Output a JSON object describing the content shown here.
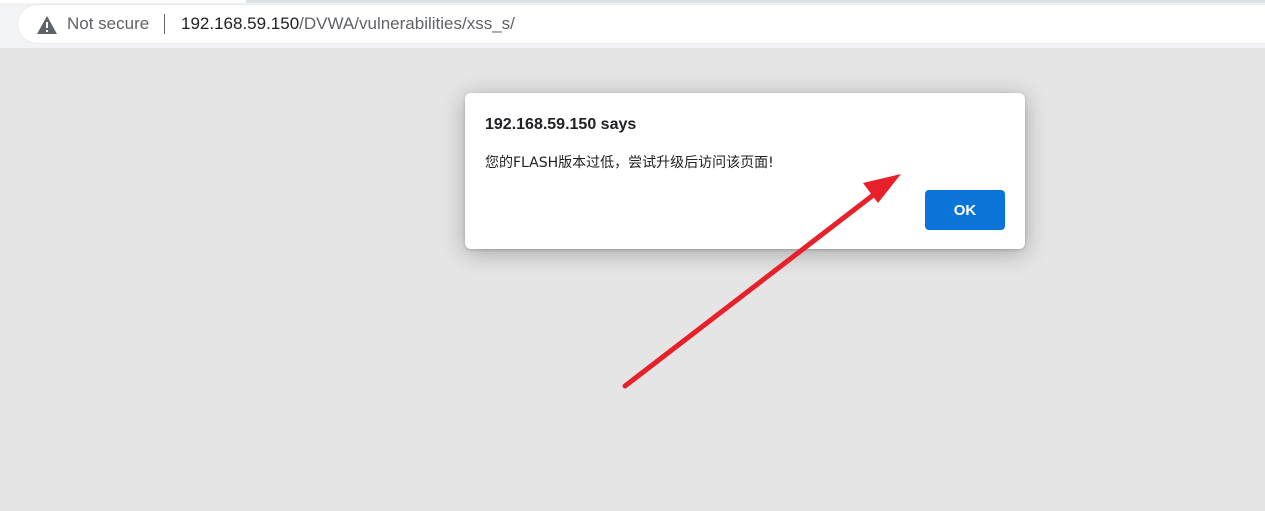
{
  "browser": {
    "security_label": "Not secure",
    "url_host": "192.168.59.150",
    "url_path": "/DVWA/vulnerabilities/xss_s/",
    "warning_icon": "warning-triangle-icon"
  },
  "dialog": {
    "title": "192.168.59.150 says",
    "message": "您的FLASH版本过低，尝试升级后访问该页面!",
    "ok_label": "OK",
    "button_color": "#0b74d8"
  },
  "annotation": {
    "arrow_color": "#e8202a",
    "arrow_target": "ok-button"
  }
}
